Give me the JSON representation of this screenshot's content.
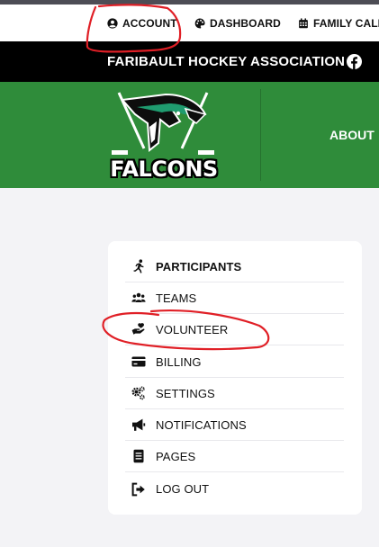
{
  "topnav": {
    "items": [
      {
        "label": "ACCOUNT",
        "icon": "user-circle-icon"
      },
      {
        "label": "DASHBOARD",
        "icon": "palette-icon"
      },
      {
        "label": "FAMILY CALE",
        "icon": "calendar-icon"
      }
    ]
  },
  "header": {
    "org_name": "FARIBAULT HOCKEY ASSOCIATION",
    "social_icon": "facebook-icon"
  },
  "banner": {
    "logo_text": "FALCONS",
    "nav_about": "ABOUT"
  },
  "menu": {
    "items": [
      {
        "label": "PARTICIPANTS",
        "icon": "running-person-icon",
        "active": true
      },
      {
        "label": "TEAMS",
        "icon": "users-icon",
        "active": false
      },
      {
        "label": "VOLUNTEER",
        "icon": "hand-holding-heart-icon",
        "active": false
      },
      {
        "label": "BILLING",
        "icon": "credit-card-icon",
        "active": false
      },
      {
        "label": "SETTINGS",
        "icon": "gears-icon",
        "active": false
      },
      {
        "label": "NOTIFICATIONS",
        "icon": "megaphone-icon",
        "active": false
      },
      {
        "label": "PAGES",
        "icon": "document-icon",
        "active": false
      },
      {
        "label": "LOG OUT",
        "icon": "sign-out-icon",
        "active": false
      }
    ]
  },
  "colors": {
    "brand_green": "#2f8c3a",
    "header_black": "#000000",
    "annotation_red": "#e01f26"
  }
}
